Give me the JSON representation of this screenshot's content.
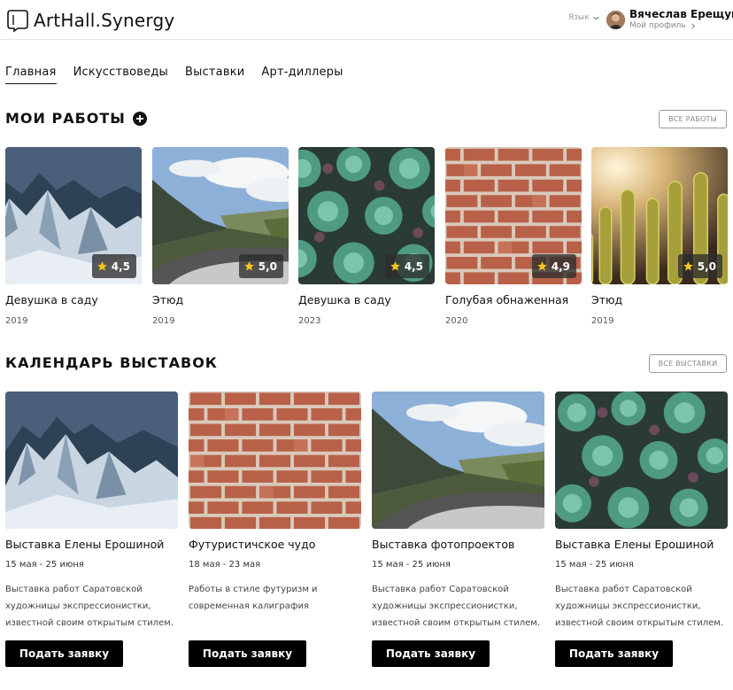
{
  "header": {
    "logo_text": "ArtHall.Synergy",
    "language_label": "Язык",
    "user_name": "Вячеслав Ерещук",
    "profile_link": "Мой профиль"
  },
  "nav": {
    "items": [
      {
        "label": "Главная",
        "active": true
      },
      {
        "label": "Искусствоведы"
      },
      {
        "label": "Выставки"
      },
      {
        "label": "Арт-диллеры"
      }
    ]
  },
  "works": {
    "title": "МОИ РАБОТЫ",
    "all_button": "ВСЕ РАБОТЫ",
    "items": [
      {
        "title": "Девушка в саду",
        "year": "2019",
        "rating": "4,5",
        "image": "mountains"
      },
      {
        "title": "Этюд",
        "year": "2019",
        "rating": "5,0",
        "image": "road"
      },
      {
        "title": "Девушка в саду",
        "year": "2023",
        "rating": "4,5",
        "image": "succulents"
      },
      {
        "title": "Голубая обнаженная",
        "year": "2020",
        "rating": "4,9",
        "image": "bricks"
      },
      {
        "title": "Этюд",
        "year": "2019",
        "rating": "5,0",
        "image": "cactus"
      }
    ]
  },
  "exhibitions": {
    "title": "КАЛЕНДАРЬ ВЫСТАВОК",
    "all_button": "ВСЕ ВЫСТАВКИ",
    "apply_label": "Подать заявку",
    "items": [
      {
        "title": "Выставка Елены Ерошиной",
        "dates": "15 мая - 25 июня",
        "description": "Выставка работ Саратовской художницы экспрессионистки, известной своим открытым стилем.",
        "image": "mountains"
      },
      {
        "title": "Футуристичское чудо",
        "dates": "18 мая - 23 мая",
        "description": "Работы в стиле футуризм и современная калиграфия",
        "image": "bricks"
      },
      {
        "title": "Выставка фотопроектов",
        "dates": "15 мая - 25 июня",
        "description": "Выставка работ Саратовской художницы экспрессионистки, известной своим открытым стилем.",
        "image": "road"
      },
      {
        "title": "Выставка Елены Ерошиной",
        "dates": "15 мая - 25 июня",
        "description": "Выставка работ Саратовской художницы экспрессионистки, известной своим открытым стилем.",
        "image": "succulents"
      }
    ]
  },
  "colors": {
    "primary": "#000000",
    "star": "#f5c518",
    "border": "#e6e6e6"
  },
  "icons": {
    "logo": "frame-outline-icon",
    "plus": "plus-circle-icon",
    "star": "star-icon"
  }
}
